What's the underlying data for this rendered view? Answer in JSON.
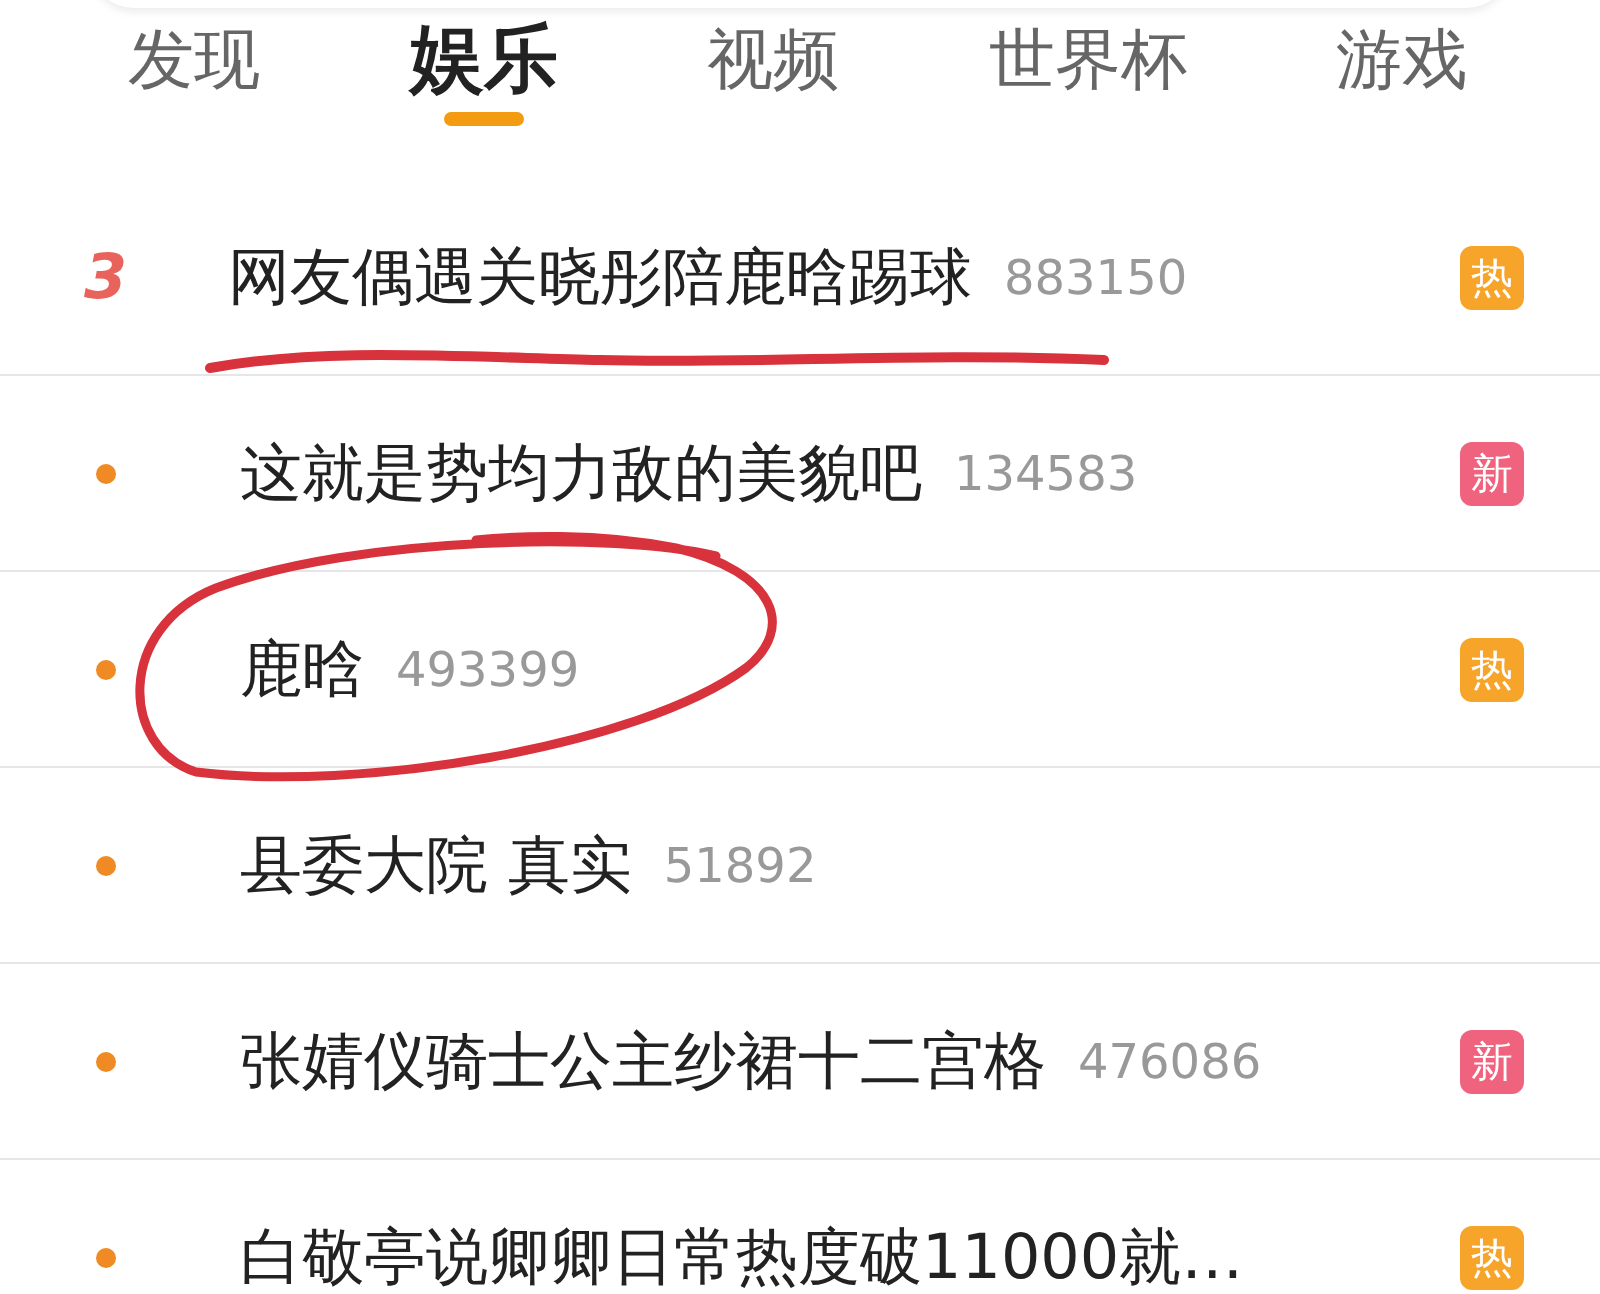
{
  "tabs": [
    {
      "label": "发现",
      "selected": false
    },
    {
      "label": "娱乐",
      "selected": true
    },
    {
      "label": "视频",
      "selected": false
    },
    {
      "label": "世界杯",
      "selected": false
    },
    {
      "label": "游戏",
      "selected": false
    }
  ],
  "rows": [
    {
      "marker": {
        "kind": "number",
        "text": "3"
      },
      "title": "网友偶遇关晓彤陪鹿晗踢球",
      "count": "883150",
      "badge": {
        "text": "热",
        "color": "#f7a52a"
      },
      "underlined": true,
      "circled": false
    },
    {
      "marker": {
        "kind": "dot"
      },
      "title": "这就是势均力敌的美貌吧",
      "count": "134583",
      "badge": {
        "text": "新",
        "color": "#f0637e"
      },
      "underlined": false,
      "circled": false
    },
    {
      "marker": {
        "kind": "dot"
      },
      "title": "鹿晗",
      "count": "493399",
      "badge": {
        "text": "热",
        "color": "#f7a52a"
      },
      "underlined": false,
      "circled": true
    },
    {
      "marker": {
        "kind": "dot"
      },
      "title": "县委大院 真实",
      "count": "51892",
      "underlined": false,
      "circled": false
    },
    {
      "marker": {
        "kind": "dot"
      },
      "title": "张婧仪骑士公主纱裙十二宫格",
      "count": "476086",
      "badge": {
        "text": "新",
        "color": "#f0637e"
      },
      "underlined": false,
      "circled": false
    },
    {
      "marker": {
        "kind": "dot"
      },
      "title": "白敬亭说卿卿日常热度破11000就…",
      "badge": {
        "text": "热",
        "color": "#f7a52a"
      },
      "underlined": false,
      "circled": false
    }
  ]
}
